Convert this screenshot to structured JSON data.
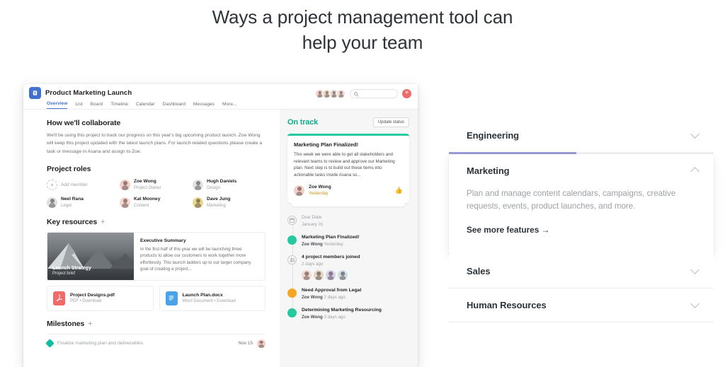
{
  "headline": {
    "line1": "Ways a project management tool can",
    "line2": "help your team"
  },
  "app": {
    "project_title": "Product Marketing Launch",
    "tabs": [
      {
        "label": "Overview",
        "active": true
      },
      {
        "label": "List",
        "active": false
      },
      {
        "label": "Board",
        "active": false
      },
      {
        "label": "Timeline",
        "active": false
      },
      {
        "label": "Calendar",
        "active": false
      },
      {
        "label": "Dashboard",
        "active": false
      },
      {
        "label": "Messages",
        "active": false
      },
      {
        "label": "More...",
        "active": false
      }
    ],
    "search_placeholder": "",
    "add_button_label": "+",
    "collaborate": {
      "heading": "How we'll collaborate",
      "body": "We'll be using this project to track our progress on this year's big upcoming product launch. Zoe Wong will keep this project updated with the latest launch plans. For launch-related questions please create a task or message in Asana and assign to Zoe."
    },
    "project_roles": {
      "heading": "Project roles",
      "add_member_label": "Add member",
      "members": [
        {
          "name": "Zoe Wong",
          "role": "Project Owner",
          "color": "#f2cfc8"
        },
        {
          "name": "Hugh Daniels",
          "role": "Design",
          "color": "#dfe3e6"
        },
        {
          "name": "Neel Rana",
          "role": "Legal",
          "color": "#dcdfe2"
        },
        {
          "name": "Kat Mooney",
          "role": "Content",
          "color": "#f6d6cf"
        },
        {
          "name": "Dave Jung",
          "role": "Marketing",
          "color": "#e9d98f"
        }
      ]
    },
    "key_resources": {
      "heading": "Key resources",
      "add_label": "+",
      "featured": {
        "overlay_title": "Launch Strategy",
        "overlay_sub": "Project brief",
        "title": "Executive Summary",
        "description": "In the first half of this year we will be launching three products to allow our customers to work together more effortlessly. This launch ladders up to our larger company goal of creating a project..."
      },
      "files": [
        {
          "name": "Project Designs.pdf",
          "meta": "PDF • Download",
          "type": "pdf"
        },
        {
          "name": "Launch Plan.docx",
          "meta": "Word Document • Download",
          "type": "doc"
        }
      ]
    },
    "milestones": {
      "heading": "Milestones",
      "add_label": "+",
      "rows": [
        {
          "label": "Finalize marketing plan and deliverables",
          "date": "Nov 15"
        }
      ]
    },
    "status": {
      "state": "On track",
      "update_button": "Update status",
      "title": "Marketing Plan Finalized!",
      "text": "This week we were able to get all stakeholders and relevant teams to review and approve our Marketing plan. Next step is to build out these items into actionable tasks inside Asana so...",
      "author": "Zoe Wong",
      "time": "Yesterday"
    },
    "activity": [
      {
        "title": "Due Date",
        "sub": "January 31",
        "dot": "outline",
        "icon": "calendar-icon",
        "muted": true
      },
      {
        "title": "Marketing Plan Finalized!",
        "author": "Zoe Wong",
        "time": "Yesterday",
        "dot": "green"
      },
      {
        "title": "4 project members joined",
        "sub": "2 days ago",
        "dot": "outline",
        "icon": "people-icon",
        "avatars": 4
      },
      {
        "title": "Need Approval from Legal",
        "author": "Zoe Wong",
        "time": "2 days ago",
        "dot": "amber"
      },
      {
        "title": "Determining Marketing Resourcing",
        "author": "Zoe Wong",
        "time": "3 days ago",
        "dot": "green"
      }
    ]
  },
  "accordion": {
    "accent_color": "#9b9bd6",
    "progress_percent": 48,
    "items": [
      {
        "title": "Engineering",
        "expanded": false,
        "description": "",
        "link": ""
      },
      {
        "title": "Marketing",
        "expanded": true,
        "description": "Plan and manage content calendars, campaigns, creative requests, events, product launches, and more.",
        "link": "See more features →"
      },
      {
        "title": "Sales",
        "expanded": false,
        "description": "",
        "link": ""
      },
      {
        "title": "Human Resources",
        "expanded": false,
        "description": "",
        "link": ""
      }
    ]
  }
}
